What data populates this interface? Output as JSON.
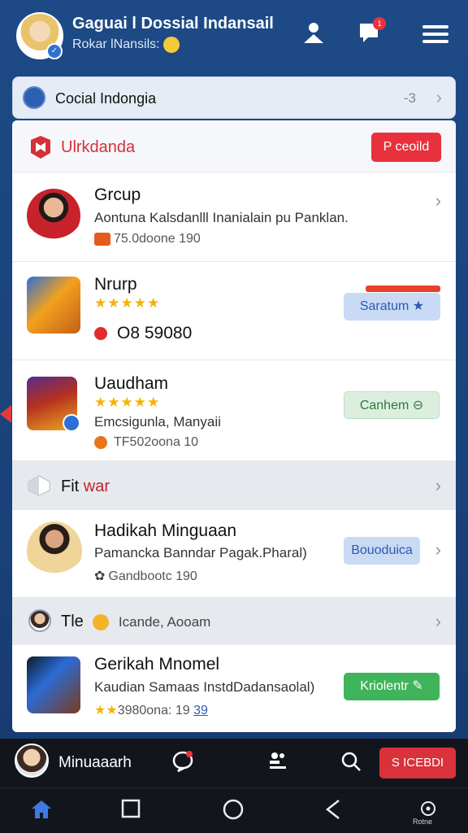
{
  "header": {
    "title": "Gaguai l Dossial Indansail",
    "subtitle": "Rokar lNansils:",
    "notification_count": "1"
  },
  "topbar": {
    "label": "Cocial Indongia",
    "count": "-3"
  },
  "brand": {
    "name": "Ulrkdanda",
    "button": "P ceoild"
  },
  "items": [
    {
      "title": "Grcup",
      "line": "Aontuna Kalsdanlll Inanialain pu Panklan.",
      "meta": "75.0doone 190"
    },
    {
      "title": "Nrurp",
      "rating": "★★★★★",
      "value": "O8 59080",
      "button": "Saratum"
    },
    {
      "title": "Uaudham",
      "rating": "★★★★★",
      "line": "Emcsigunla, Manyaii",
      "meta": "TF502oona 10",
      "button": "Canhem"
    }
  ],
  "section1": {
    "label_main": "Fit",
    "label_accent": "war"
  },
  "item4": {
    "title": "Hadikah Minguaan",
    "line": "Pamancka Banndar Pagak.Pharal)",
    "meta": "Gandbootc 190",
    "button": "Bouoduica"
  },
  "section2": {
    "label": "Tle",
    "sub": "Icande, Aooam"
  },
  "item5": {
    "title": "Gerikah Mnomel",
    "line": "Kaudian Samaas InstdDadansaolal)",
    "meta": "3980ona: 19",
    "meta_accent": "39",
    "button": "Kriolentr"
  },
  "bottombar": {
    "name": "Minuaaarh",
    "button": "S ICEBDI"
  },
  "sysnav": {
    "tiny_label": "Rotne"
  },
  "colors": {
    "accent_red": "#e8313c",
    "header_blue": "#1d4a86",
    "green": "#3fb45a"
  }
}
